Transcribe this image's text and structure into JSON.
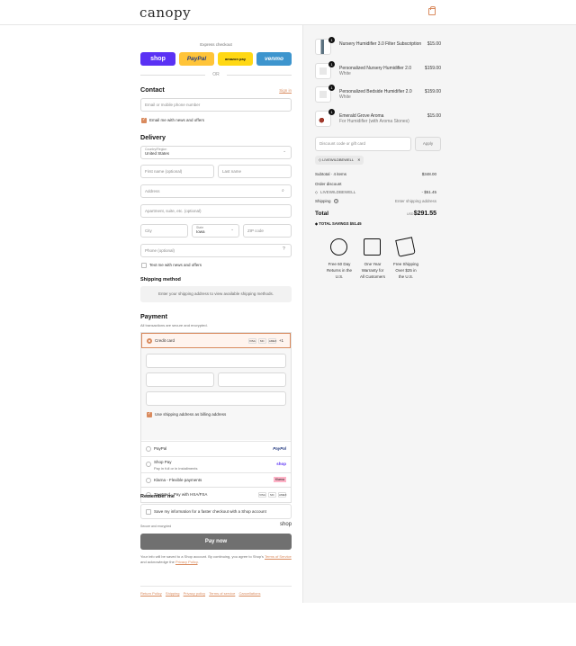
{
  "brand": {
    "logo": "canopy"
  },
  "express": {
    "label": "Express checkout",
    "shop": "shop",
    "paypal": "PayPal",
    "amazon": "amazon pay",
    "venmo": "venmo",
    "or": "OR"
  },
  "contact": {
    "heading": "Contact",
    "signin": "Sign in",
    "placeholder": "Email or mobile phone number",
    "news": "Email me with news and offers"
  },
  "delivery": {
    "heading": "Delivery",
    "country_label": "Country/Region",
    "country": "United States",
    "first": "First name (optional)",
    "last": "Last name",
    "address": "Address",
    "apt": "Apartment, suite, etc. (optional)",
    "city": "City",
    "state_label": "State",
    "state": "Iowa",
    "zip": "ZIP code",
    "phone": "Phone (optional)",
    "text_news": "Text me with news and offers"
  },
  "shipping": {
    "heading": "Shipping method",
    "note": "Enter your shipping address to view available shipping methods."
  },
  "payment": {
    "heading": "Payment",
    "note": "All transactions are secure and encrypted.",
    "credit": "Credit card",
    "billing": "Use shipping address as billing address",
    "paypal": "PayPal",
    "shoppay": "Shop Pay",
    "shopsub": "Pay in full or in installments",
    "klarna": "Klarna - Flexible payments",
    "truemed": "TrueMed - Pay with HSA/FSA",
    "more": "+1",
    "visa": "VISA",
    "mc": "MC",
    "amex": "AMEX",
    "klarna_badge": "Klarna",
    "shop_badge": "shop"
  },
  "remember": {
    "heading": "Remember me",
    "save": "Save my information for a faster checkout with a Shop account",
    "secure": "Secure and encrypted",
    "shop": "shop"
  },
  "paynow": "Pay now",
  "legal": {
    "text1": "Your info will be saved to a Shop account. By continuing, you agree to Shop's",
    "terms": "Terms of Service",
    "and": "and acknowledge the",
    "privacy": "Privacy Policy"
  },
  "footer": {
    "links": [
      "Return Policy",
      "Shipping",
      "Privacy policy",
      "Terms of service",
      "Cancellations"
    ]
  },
  "cart": {
    "items": [
      {
        "qty": "1",
        "name": "Nursery Humidifier 3.0 Filter Subscription",
        "variant": "",
        "price": "$15.00"
      },
      {
        "qty": "1",
        "name": "Personalized Nursery Humidifier 2.0",
        "variant": "White",
        "price": "$159.00"
      },
      {
        "qty": "1",
        "name": "Personalized Bedside Humidifier 2.0",
        "variant": "White",
        "price": "$159.00"
      },
      {
        "qty": "1",
        "name": "Emerald Grove Aroma",
        "variant": "For Humidifier (with Aroma Stones)",
        "price": "$15.00"
      }
    ],
    "discount_placeholder": "Discount code or gift card",
    "apply": "Apply",
    "code": "LIVEWILDBEWELL",
    "subtotal_label": "Subtotal · 4 items",
    "subtotal": "$348.00",
    "order_discount": "Order discount",
    "discount_code": "LIVEWILDBEWELL",
    "discount": "- $51.45",
    "shipping_label": "Shipping",
    "shipping_value": "Enter shipping address",
    "total_label": "Total",
    "currency": "USD",
    "total": "$291.55",
    "savings_label": "TOTAL SAVINGS",
    "savings": "$51.45"
  },
  "benefits": [
    "Free 60 Day Returns in the U.S.",
    "One Year Warranty for All Customers",
    "Free Shipping Over $25 in the U.S."
  ]
}
